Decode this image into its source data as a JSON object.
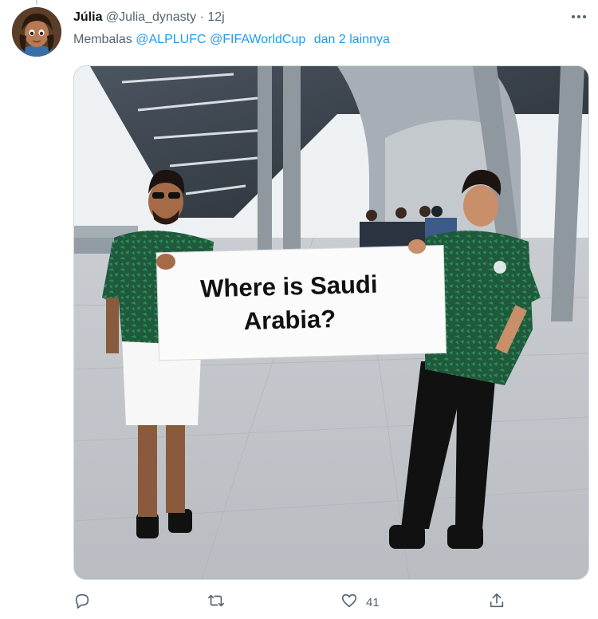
{
  "tweet": {
    "display_name": "Júlia",
    "handle": "@Julia_dynasty",
    "separator": "·",
    "time": "12j",
    "reply_prefix": "Membalas",
    "mentions": [
      "@ALPLUFC",
      "@FIFAWorldCup"
    ],
    "reply_suffix": "dan 2 lainnya",
    "media": {
      "sign_line1": "Where is Saudi",
      "sign_line2": "Arabia?"
    },
    "actions": {
      "reply_icon": "comment-icon",
      "retweet_icon": "retweet-icon",
      "like_icon": "heart-icon",
      "like_count": "41",
      "share_icon": "share-icon"
    }
  },
  "colors": {
    "accent": "#1d9bf0",
    "text_secondary": "#536471",
    "jersey_green": "#1f5a3c"
  }
}
